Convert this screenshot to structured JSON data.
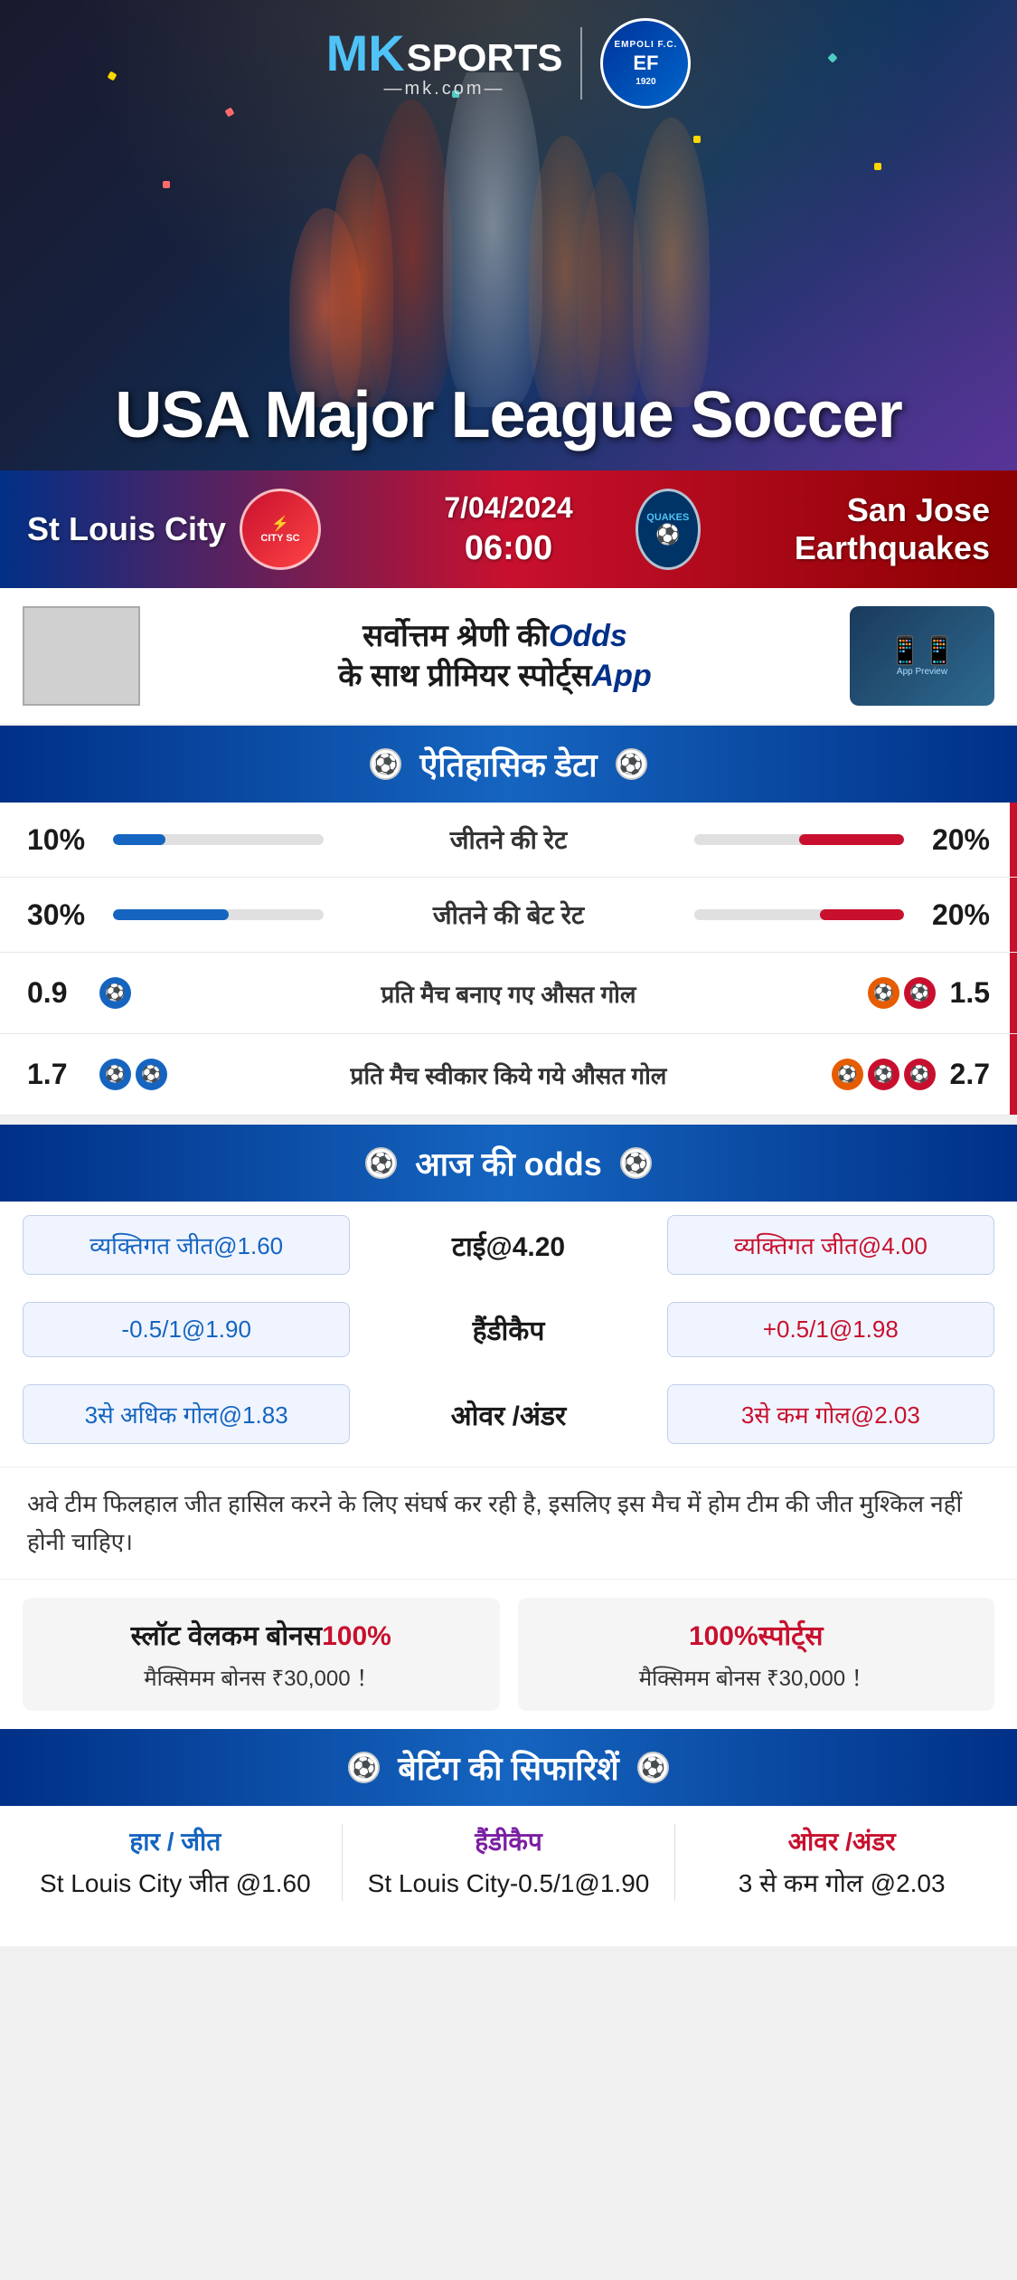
{
  "brand": {
    "mk": "MK",
    "sports": "SPORTS",
    "com": "—mk.com—",
    "empoli": "EMPOLI F.C.",
    "empoli_year": "1920"
  },
  "hero": {
    "title": "USA Major League Soccer"
  },
  "match": {
    "team_home": "St Louis City",
    "team_away": "San Jose Earthquakes",
    "date": "7/04/2024",
    "time": "06:00",
    "home_badge": "CITY SC",
    "away_badge": "QUAKES"
  },
  "ad": {
    "line1": "सर्वोत्तम श्रेणी की",
    "line1_bold": "Odds",
    "line2": "के साथ प्रीमियर स्पोर्ट्स",
    "line2_bold": "App"
  },
  "historical_section": {
    "title": "ऐतिहासिक डेटा"
  },
  "stats": [
    {
      "label": "जीतने की रेट",
      "left_val": "10%",
      "right_val": "20%",
      "left_pct": 25,
      "right_pct": 50
    },
    {
      "label": "जीतने की बेट रेट",
      "left_val": "30%",
      "right_val": "20%",
      "left_pct": 55,
      "right_pct": 40
    }
  ],
  "goal_stats": [
    {
      "label": "प्रति मैच बनाए गए औसत गोल",
      "left_val": "0.9",
      "right_val": "1.5",
      "left_balls": 1,
      "right_balls": 2
    },
    {
      "label": "प्रति मैच स्वीकार किये गये औसत गोल",
      "left_val": "1.7",
      "right_val": "2.7",
      "left_balls": 2,
      "right_balls": 3
    }
  ],
  "odds_section": {
    "title": "आज की odds"
  },
  "odds": [
    {
      "left": "व्यक्तिगत जीत@1.60",
      "center": "टाई@4.20",
      "right": "व्यक्तिगत जीत@4.00"
    },
    {
      "left": "-0.5/1@1.90",
      "center": "हैंडीकैप",
      "right": "+0.5/1@1.98"
    },
    {
      "left": "3से अधिक गोल@1.83",
      "center": "ओवर /अंडर",
      "right": "3से कम गोल@2.03"
    }
  ],
  "commentary": "अवे टीम फिलहाल जीत हासिल करने के लिए संघर्ष कर रही है, इसलिए इस मैच में होम टीम की जीत मुश्किल नहीं होनी चाहिए।",
  "bonus": [
    {
      "title_main": "स्लॉट वेलकम बोनस",
      "title_highlight": "100%",
      "sub": "मैक्सिमम बोनस ₹30,000 ！"
    },
    {
      "title_main": "100%",
      "title_highlight": "स्पोर्ट्स",
      "sub": "मैक्सिमम बोनस  ₹30,000 ！"
    }
  ],
  "betting_section": {
    "title": "बेटिंग की सिफारिशें"
  },
  "betting_recs": [
    {
      "label": "हार / जीत",
      "value": "St Louis City जीत @1.60",
      "color": "blue"
    },
    {
      "label": "हैंडीकैप",
      "value": "St Louis City-0.5/1@1.90",
      "color": "purple"
    },
    {
      "label": "ओवर /अंडर",
      "value": "3 से कम गोल @2.03",
      "color": "red"
    }
  ]
}
